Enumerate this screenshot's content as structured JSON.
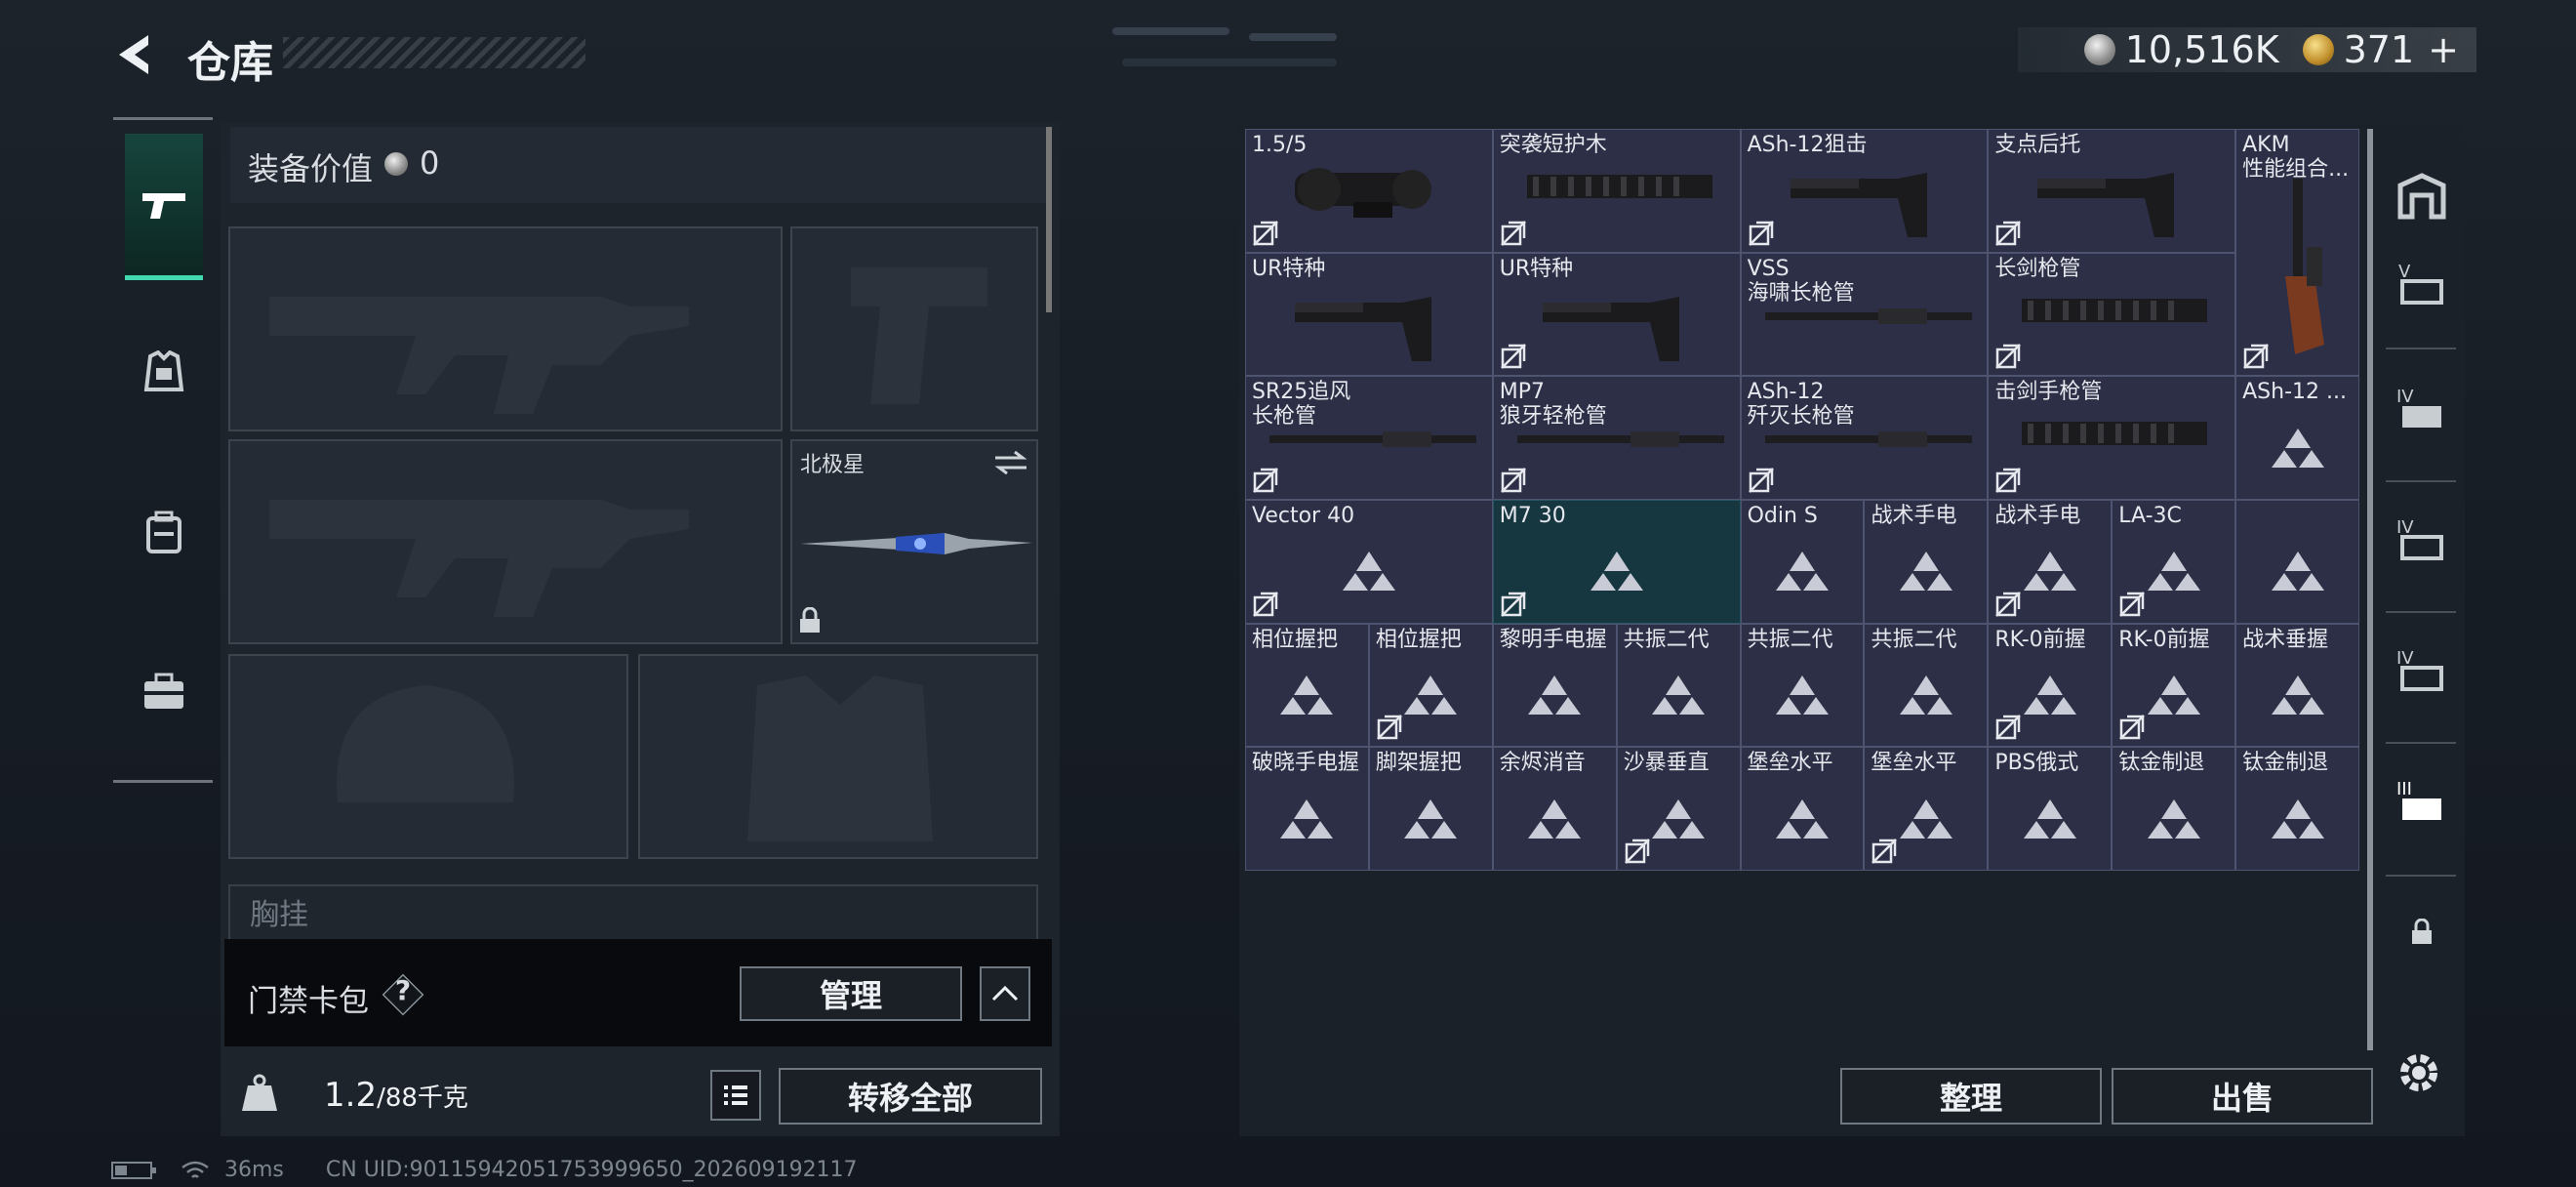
{
  "header": {
    "title": "仓库"
  },
  "currency": {
    "coins": "10,516K",
    "gems": "371",
    "plus_glyph": "+"
  },
  "equipment": {
    "label": "装备价值",
    "value": "0"
  },
  "slots": {
    "melee_name": "北极星"
  },
  "chest_label": "胸挂",
  "keycard": {
    "label": "门禁卡包",
    "help": "?",
    "manage": "管理"
  },
  "bottom": {
    "weight_current": "1.2",
    "weight_rest": "/88千克",
    "transfer_all": "转移全部",
    "sort": "整理",
    "sell": "出售"
  },
  "status": {
    "ping": "36ms",
    "uid": "CN UID:9011594205175399965​0_202609192117"
  },
  "grid_items": [
    {
      "label": "1.5/5",
      "badge": true,
      "icon": "scope-image"
    },
    {
      "label": "突袭短护木",
      "badge": true,
      "icon": "handguard-image"
    },
    {
      "label": "ASh-12狙击",
      "badge": true,
      "icon": "stock-image"
    },
    {
      "label": "支点后托",
      "badge": true,
      "icon": "stock-image"
    },
    {
      "label": "AKM\n性能组合...",
      "badge": true,
      "icon": "rifle-image"
    },
    {
      "label": "UR特种",
      "badge": false,
      "icon": "stock-image"
    },
    {
      "label": "UR特种",
      "badge": true,
      "icon": "stock-image"
    },
    {
      "label": "VSS\n海啸长枪管",
      "badge": false,
      "icon": "barrel-image"
    },
    {
      "label": "长剑枪管",
      "badge": true,
      "icon": "handguard-image"
    },
    {
      "label": "SR25追风\n长枪管",
      "badge": true,
      "icon": "barrel-image"
    },
    {
      "label": "MP7\n狼牙轻枪管",
      "badge": true,
      "icon": "barrel-image"
    },
    {
      "label": "ASh-12\n歼灭长枪管",
      "badge": true,
      "icon": "barrel-image"
    },
    {
      "label": "击剑手枪管",
      "badge": true,
      "icon": "handguard-image"
    },
    {
      "label": "ASh-12 ...",
      "badge": false,
      "icon": "placeholder-triangle"
    },
    {
      "label": "Vector 40",
      "badge": true,
      "icon": "placeholder-triangle"
    },
    {
      "label": "M7 30",
      "badge": true,
      "icon": "placeholder-triangle",
      "selected": true
    },
    {
      "label": "Odin S",
      "badge": false,
      "icon": "placeholder-triangle"
    },
    {
      "label": "战术手电",
      "badge": false,
      "icon": "placeholder-triangle"
    },
    {
      "label": "战术手电",
      "badge": true,
      "icon": "placeholder-triangle"
    },
    {
      "label": "LA-3C",
      "badge": true,
      "icon": "placeholder-triangle"
    },
    {
      "label": "相位握把",
      "badge": false,
      "icon": "placeholder-triangle"
    },
    {
      "label": "相位握把",
      "badge": true,
      "icon": "placeholder-triangle"
    },
    {
      "label": "黎明手电握",
      "badge": false,
      "icon": "placeholder-triangle"
    },
    {
      "label": "共振二代",
      "badge": false,
      "icon": "placeholder-triangle"
    },
    {
      "label": "共振二代",
      "badge": false,
      "icon": "placeholder-triangle"
    },
    {
      "label": "共振二代",
      "badge": false,
      "icon": "placeholder-triangle"
    },
    {
      "label": "RK-0前握",
      "badge": true,
      "icon": "placeholder-triangle"
    },
    {
      "label": "RK-0前握",
      "badge": true,
      "icon": "placeholder-triangle"
    },
    {
      "label": "战术垂握",
      "badge": false,
      "icon": "placeholder-triangle"
    },
    {
      "label": "破晓手电握",
      "badge": false,
      "icon": "placeholder-triangle"
    },
    {
      "label": "脚架握把",
      "badge": false,
      "icon": "placeholder-triangle"
    },
    {
      "label": "余烬消音",
      "badge": false,
      "icon": "placeholder-triangle"
    },
    {
      "label": "沙暴垂直",
      "badge": true,
      "icon": "placeholder-triangle"
    },
    {
      "label": "堡垒水平",
      "badge": false,
      "icon": "placeholder-triangle"
    },
    {
      "label": "堡垒水平",
      "badge": true,
      "icon": "placeholder-triangle"
    },
    {
      "label": "PBS俄式",
      "badge": false,
      "icon": "placeholder-triangle"
    },
    {
      "label": "钛金制退",
      "badge": false,
      "icon": "placeholder-triangle"
    },
    {
      "label": "钛金制退",
      "badge": false,
      "icon": "placeholder-triangle"
    }
  ]
}
